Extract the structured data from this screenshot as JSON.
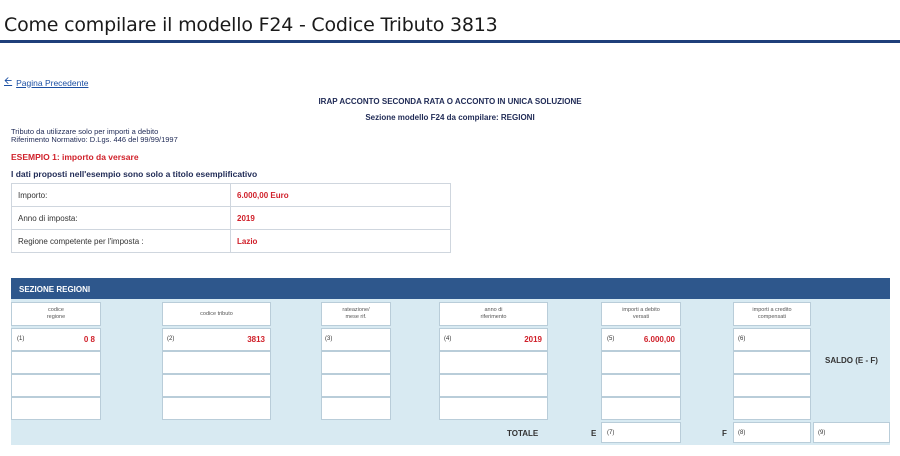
{
  "page": {
    "title": "Come compilare il modello F24 - Codice Tributo 3813",
    "back_link": "Pagina Precedente",
    "heading": "IRAP ACCONTO SECONDA RATA O ACCONTO IN UNICA SOLUZIONE",
    "subheading": "Sezione modello F24 da compilare: REGIONI",
    "info_line1": "Tributo da utilizzare solo per importi a debito",
    "info_line2": "Riferimento Normativo: D.Lgs.  446 del 99/99/1997",
    "example_title": "ESEMPIO 1: importo da versare",
    "disclaimer": "I dati proposti nell'esempio sono solo a titolo esemplificativo"
  },
  "details": [
    {
      "label": "Importo:",
      "value": "6.000,00 Euro"
    },
    {
      "label": "Anno di imposta:",
      "value": "2019"
    },
    {
      "label": "Regione competente per l'imposta :",
      "value": "Lazio"
    }
  ],
  "section": {
    "title": "SEZIONE REGIONI",
    "col_codice_regione": [
      "codice",
      "regione"
    ],
    "col_codice_tributo": "codice tributo",
    "col_rateazione": [
      "rateazione/",
      "mese rif."
    ],
    "col_anno": [
      "anno di",
      "riferimento"
    ],
    "col_importi_debito": [
      "importi a debito",
      "versati"
    ],
    "col_importi_credito": [
      "importi a credito",
      "compensati"
    ],
    "n1": "(1)",
    "n2": "(2)",
    "n3": "(3)",
    "n4": "(4)",
    "n5": "(5)",
    "n6": "(6)",
    "n7": "(7)",
    "n8": "(8)",
    "n9": "(9)",
    "val_regione": "0 8",
    "val_tributo": "3813",
    "val_anno": "2019",
    "val_importo": "6.000,00",
    "totale": "TOTALE",
    "e_label": "E",
    "f_label": "F",
    "saldo": "SALDO (E - F)"
  }
}
